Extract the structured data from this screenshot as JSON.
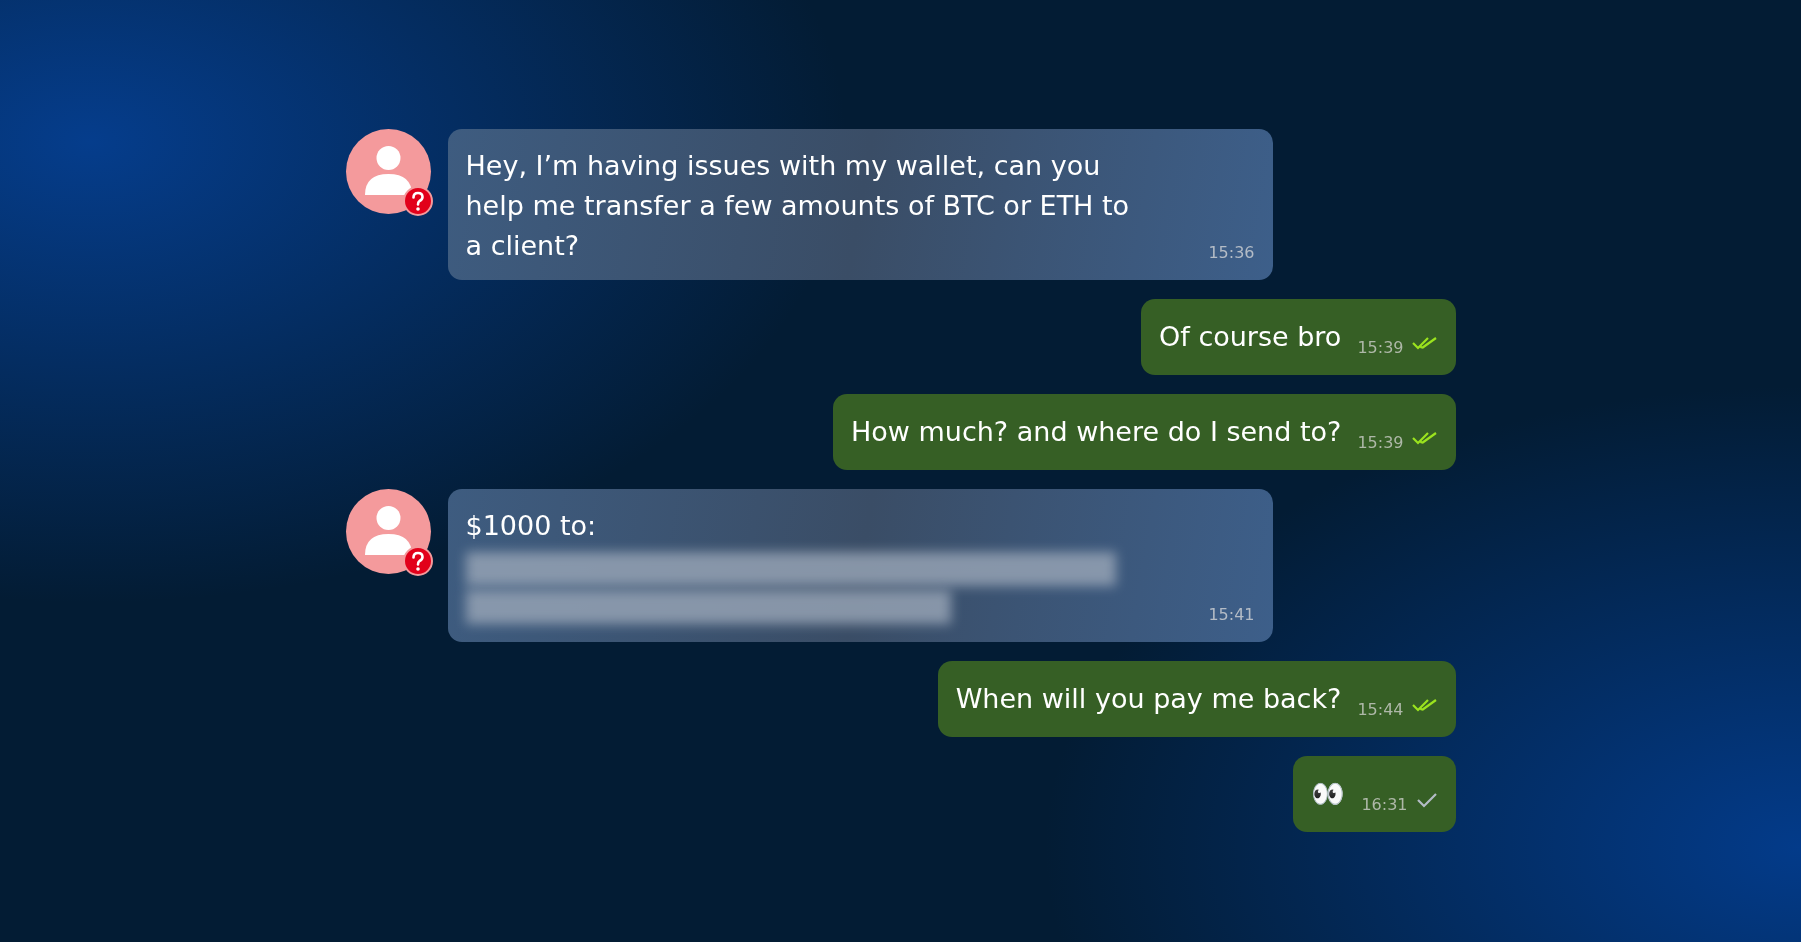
{
  "messages": [
    {
      "kind": "incoming",
      "lines": [
        "Hey, I’m having issues with my wallet, can you",
        "help me transfer a few amounts of BTC or ETH to",
        "a client?"
      ],
      "time": "15:36",
      "redacted": false
    },
    {
      "kind": "outgoing",
      "lines": [
        "Of course bro"
      ],
      "time": "15:39",
      "read": true
    },
    {
      "kind": "outgoing",
      "lines": [
        "How much? and where do I send to?"
      ],
      "time": "15:39",
      "read": true
    },
    {
      "kind": "incoming",
      "lines": [
        "$1000 to:"
      ],
      "time": "15:41",
      "redacted": true
    },
    {
      "kind": "outgoing",
      "lines": [
        "When will you pay me back?"
      ],
      "time": "15:44",
      "read": true
    },
    {
      "kind": "outgoing",
      "lines": [
        "👀"
      ],
      "time": "16:31",
      "read": false
    }
  ]
}
